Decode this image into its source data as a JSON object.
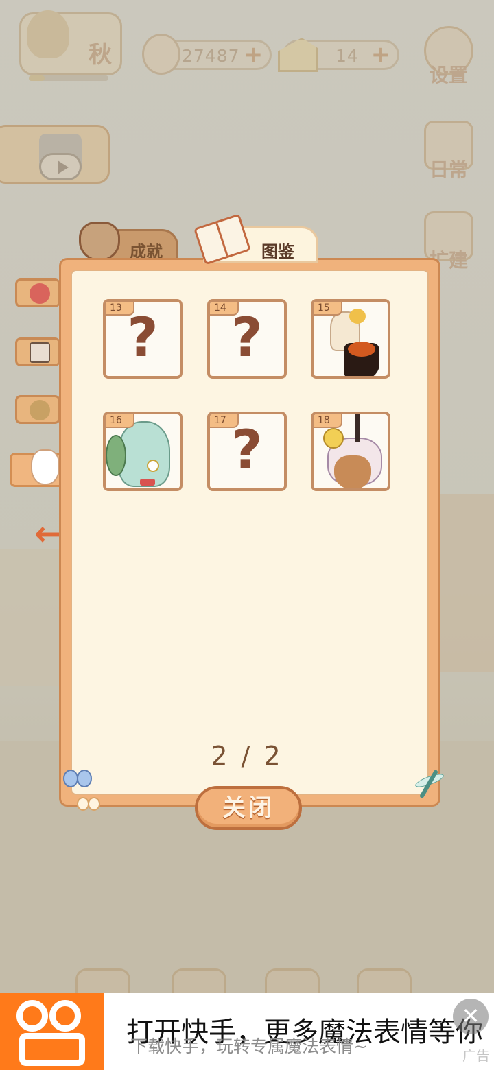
{
  "top_bar": {
    "season_label": "秋",
    "season_progress": 0.2,
    "fish_amount": "27487",
    "cheese_amount": "14",
    "plus_symbol": "+",
    "settings_label": "设置",
    "daily_label": "日常",
    "build_label": "扩建"
  },
  "tabs": {
    "achievements": "成就",
    "collection": "图鉴",
    "active": "collection"
  },
  "categories": [
    {
      "icon": "rose-icon"
    },
    {
      "icon": "photo-icon"
    },
    {
      "icon": "bouquet-icon"
    },
    {
      "icon": "cat-silhouette-icon",
      "selected": true
    }
  ],
  "cards": [
    {
      "number": "13",
      "unlocked": false,
      "placeholder": "?"
    },
    {
      "number": "14",
      "unlocked": false,
      "placeholder": "?"
    },
    {
      "number": "15",
      "unlocked": true,
      "art": "dressed-animal-portrait"
    },
    {
      "number": "16",
      "unlocked": true,
      "art": "parrot-with-monocle"
    },
    {
      "number": "17",
      "unlocked": false,
      "placeholder": "?"
    },
    {
      "number": "18",
      "unlocked": true,
      "art": "unicorn-with-flower-hat"
    }
  ],
  "pagination": {
    "text": "2 / 2"
  },
  "close_label": "关闭",
  "ad": {
    "title": "打开快手，更多魔法表情等你",
    "subtitle": "下载快手，玩转专属魔法表情~",
    "tag": "广告",
    "close_symbol": "✕",
    "brand_color": "#FF7A1A"
  },
  "colors": {
    "panel_border": "#CC8852",
    "panel_fill": "#FDF5E2",
    "accent_orange": "#F2B17A",
    "card_border": "#C48D64",
    "question_mark": "#8A4C34"
  }
}
